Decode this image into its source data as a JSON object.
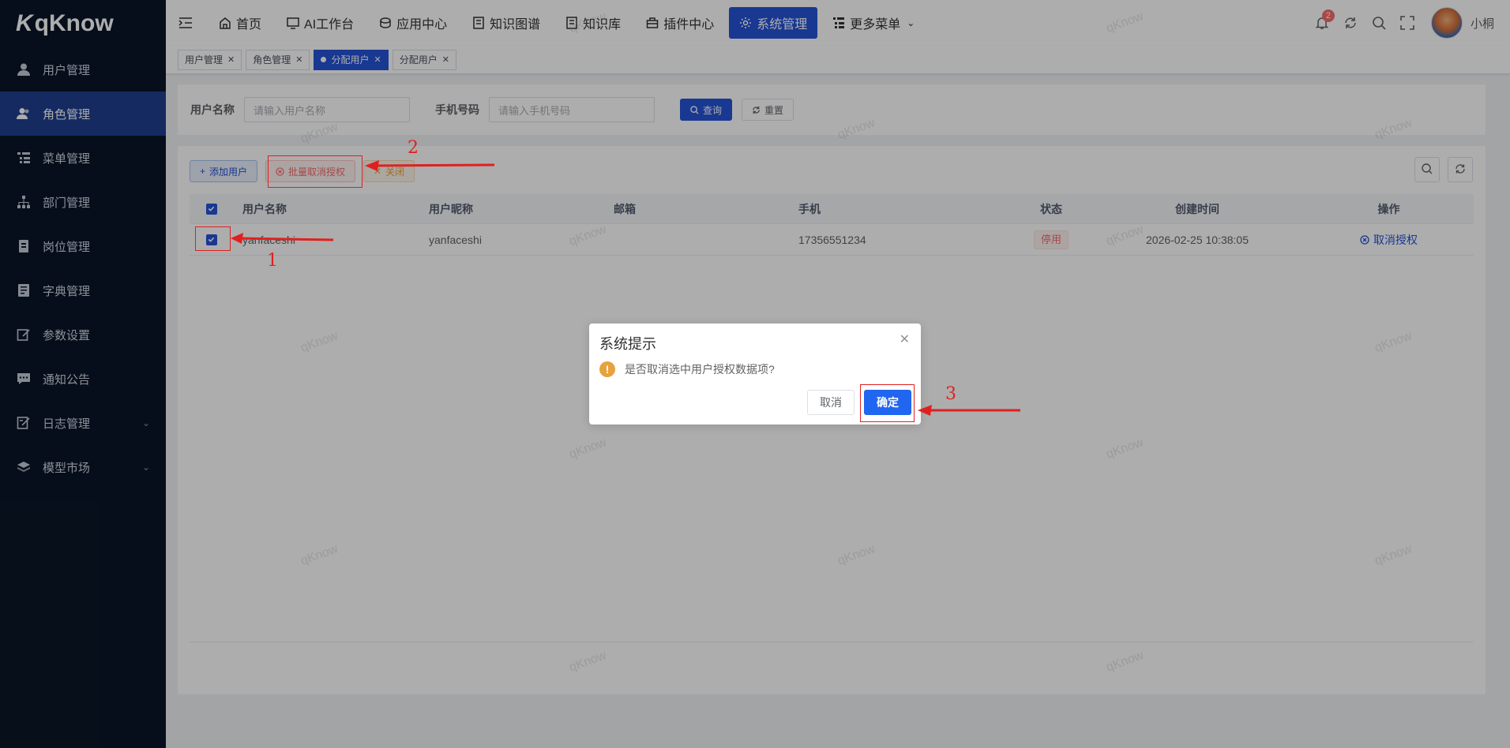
{
  "app": {
    "logo_text": "qKnow",
    "logo_mark": "K"
  },
  "sidebar": {
    "items": [
      {
        "label": "用户管理",
        "icon": "user-icon",
        "active": false
      },
      {
        "label": "角色管理",
        "icon": "users-icon",
        "active": true
      },
      {
        "label": "菜单管理",
        "icon": "tree-table-icon",
        "active": false
      },
      {
        "label": "部门管理",
        "icon": "org-tree-icon",
        "active": false
      },
      {
        "label": "岗位管理",
        "icon": "post-icon",
        "active": false
      },
      {
        "label": "字典管理",
        "icon": "dict-icon",
        "active": false
      },
      {
        "label": "参数设置",
        "icon": "edit-icon",
        "active": false
      },
      {
        "label": "通知公告",
        "icon": "message-icon",
        "active": false
      },
      {
        "label": "日志管理",
        "icon": "log-icon",
        "active": false,
        "expandable": true
      },
      {
        "label": "模型市场",
        "icon": "layers-icon",
        "active": false,
        "expandable": true
      }
    ]
  },
  "topnav": {
    "items": [
      {
        "label": "首页",
        "icon": "home-icon"
      },
      {
        "label": "AI工作台",
        "icon": "monitor-icon"
      },
      {
        "label": "应用中心",
        "icon": "stack-icon"
      },
      {
        "label": "知识图谱",
        "icon": "book-icon"
      },
      {
        "label": "知识库",
        "icon": "book-icon"
      },
      {
        "label": "插件中心",
        "icon": "box-icon"
      },
      {
        "label": "系统管理",
        "icon": "gear-icon",
        "active": true
      },
      {
        "label": "更多菜单",
        "icon": "menu-tree-icon",
        "dropdown": true
      }
    ],
    "notification_count": "2",
    "username": "小桐"
  },
  "tags": [
    {
      "label": "用户管理"
    },
    {
      "label": "角色管理"
    },
    {
      "label": "分配用户",
      "active": true
    },
    {
      "label": "分配用户"
    }
  ],
  "search": {
    "username_label": "用户名称",
    "username_placeholder": "请输入用户名称",
    "phone_label": "手机号码",
    "phone_placeholder": "请输入手机号码",
    "query_label": "查询",
    "reset_label": "重置"
  },
  "toolbar": {
    "add_label": "添加用户",
    "batch_cancel_label": "批量取消授权",
    "close_label": "关闭"
  },
  "table": {
    "headers": [
      "用户名称",
      "用户昵称",
      "邮箱",
      "手机",
      "状态",
      "创建时间",
      "操作"
    ],
    "rows": [
      {
        "username": "yanfaceshi",
        "nickname": "yanfaceshi",
        "email": "",
        "phone": "17356551234",
        "status": "停用",
        "created": "2026-02-25 10:38:05",
        "action": "取消授权"
      }
    ]
  },
  "dialog": {
    "title": "系统提示",
    "message": "是否取消选中用户授权数据项?",
    "cancel_label": "取消",
    "confirm_label": "确定"
  },
  "annotations": {
    "n1": "1",
    "n2": "2",
    "n3": "3"
  },
  "watermark": "qKnow",
  "colors": {
    "primary": "#2453d6",
    "sidebar_bg": "#0a1628",
    "danger": "#f56c6c",
    "warning": "#e6a23c",
    "annotation": "#e02020"
  }
}
